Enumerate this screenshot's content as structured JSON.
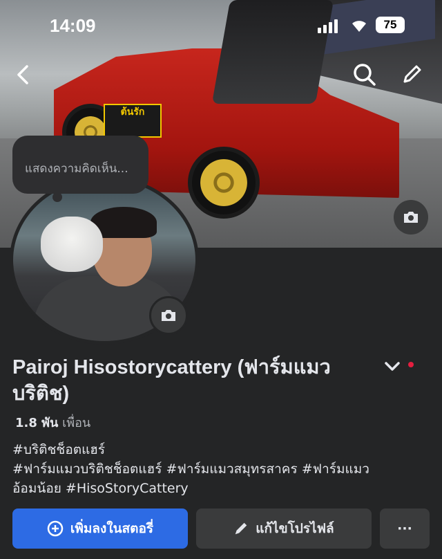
{
  "status_bar": {
    "time": "14:09",
    "battery": "75"
  },
  "cover": {
    "decal_text": "ต้นรัก"
  },
  "note_bubble": {
    "text": "แสดงความคิดเห็น..."
  },
  "profile": {
    "name": "Pairoj Hisostorycattery (ฟาร์มแมว บริติช)",
    "friends_count": "1.8 พัน",
    "friends_label": "เพื่อน",
    "bio_line1": "#บริติชช็อตแฮร์",
    "bio_line2": "#ฟาร์มแมวบริติชช็อตแฮร์ #ฟาร์มแมวสมุทรสาคร #ฟาร์มแมว",
    "bio_line3": "อ้อมน้อย #HisoStoryCattery"
  },
  "actions": {
    "add_story": "เพิ่มลงในสตอรี่",
    "edit_profile": "แก้ไขโปรไฟล์",
    "more": "···"
  },
  "icons": [
    "back-icon",
    "search-icon",
    "edit-pencil-icon",
    "camera-icon",
    "chevron-down-icon",
    "plus-circle-icon",
    "more-icon"
  ],
  "colors": {
    "primary_button": "#2d6be4",
    "secondary_button": "#3a3b3c",
    "background": "#242526",
    "notification_dot": "#e41e3f"
  }
}
